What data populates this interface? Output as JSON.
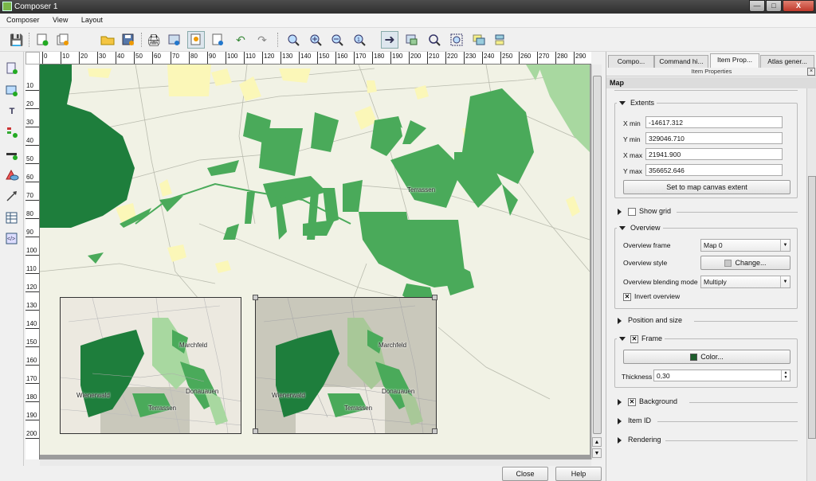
{
  "window": {
    "title": "Composer 1",
    "min": "—",
    "max": "□",
    "close": "X"
  },
  "menu": [
    "Composer",
    "View",
    "Layout"
  ],
  "toolbar": {
    "icons": [
      "save-icon",
      "new-composer-icon",
      "duplicate-composer-icon",
      "open-template-icon",
      "save-template-icon",
      "print-icon",
      "export-image-icon",
      "export-svg-icon",
      "export-pdf-icon",
      "undo-icon",
      "redo-icon",
      "zoom-full-icon",
      "zoom-in-icon",
      "zoom-out-icon",
      "zoom-actual-icon",
      "select-move-icon",
      "move-content-icon",
      "pan-icon",
      "zoom-tool-icon",
      "group-icon",
      "raise-icon"
    ]
  },
  "lefttools": [
    "add-map-icon",
    "add-image-icon",
    "add-label-icon",
    "add-legend-icon",
    "add-scalebar-icon",
    "add-shape-icon",
    "add-arrow-icon",
    "add-table-icon",
    "add-html-icon"
  ],
  "ruler": {
    "h": [
      "0",
      "10",
      "20",
      "30",
      "40",
      "50",
      "60",
      "70",
      "80",
      "90",
      "100",
      "110",
      "120",
      "130",
      "140",
      "150",
      "160",
      "170",
      "180",
      "190",
      "200",
      "210",
      "220",
      "230",
      "240",
      "250",
      "260",
      "270",
      "280",
      "290"
    ],
    "v": [
      "10",
      "20",
      "30",
      "40",
      "50",
      "60",
      "70",
      "80",
      "90",
      "100",
      "110",
      "120",
      "130",
      "140",
      "150",
      "160",
      "170",
      "180",
      "190",
      "200"
    ]
  },
  "map": {
    "main_label": "Terrassen",
    "ov_labels": [
      "Marchfeld",
      "Wienerwald",
      "Donauauen",
      "Terrassen"
    ],
    "colors": {
      "dark_green": "#1e7e3c",
      "mid_green": "#4aaa5a",
      "light_green": "#a8d8a0",
      "pale_yellow": "#fbf7b8",
      "paper": "#f1f2e5"
    }
  },
  "buttons": {
    "close": "Close",
    "help": "Help"
  },
  "panel": {
    "tabs": [
      "Compo...",
      "Command hi...",
      "Item Prop...",
      "Atlas gener..."
    ],
    "header": "Item Properties",
    "section": "Map",
    "extents": {
      "title": "Extents",
      "xmin_label": "X min",
      "xmin": "-14617.312",
      "ymin_label": "Y min",
      "ymin": "329046.710",
      "xmax_label": "X max",
      "xmax": "21941.900",
      "ymax_label": "Y max",
      "ymax": "356652.646",
      "set_button": "Set to map canvas extent"
    },
    "show_grid": "Show grid",
    "overview": {
      "title": "Overview",
      "frame_label": "Overview frame",
      "frame_value": "Map 0",
      "style_label": "Overview style",
      "style_button": "Change...",
      "blend_label": "Overview blending mode",
      "blend_value": "Multiply",
      "invert": "Invert overview"
    },
    "position_size": "Position and size",
    "frame": {
      "title": "Frame",
      "color_button": "Color...",
      "thickness_label": "Thickness",
      "thickness_value": "0,30"
    },
    "background": "Background",
    "item_id": "Item ID",
    "rendering": "Rendering"
  }
}
